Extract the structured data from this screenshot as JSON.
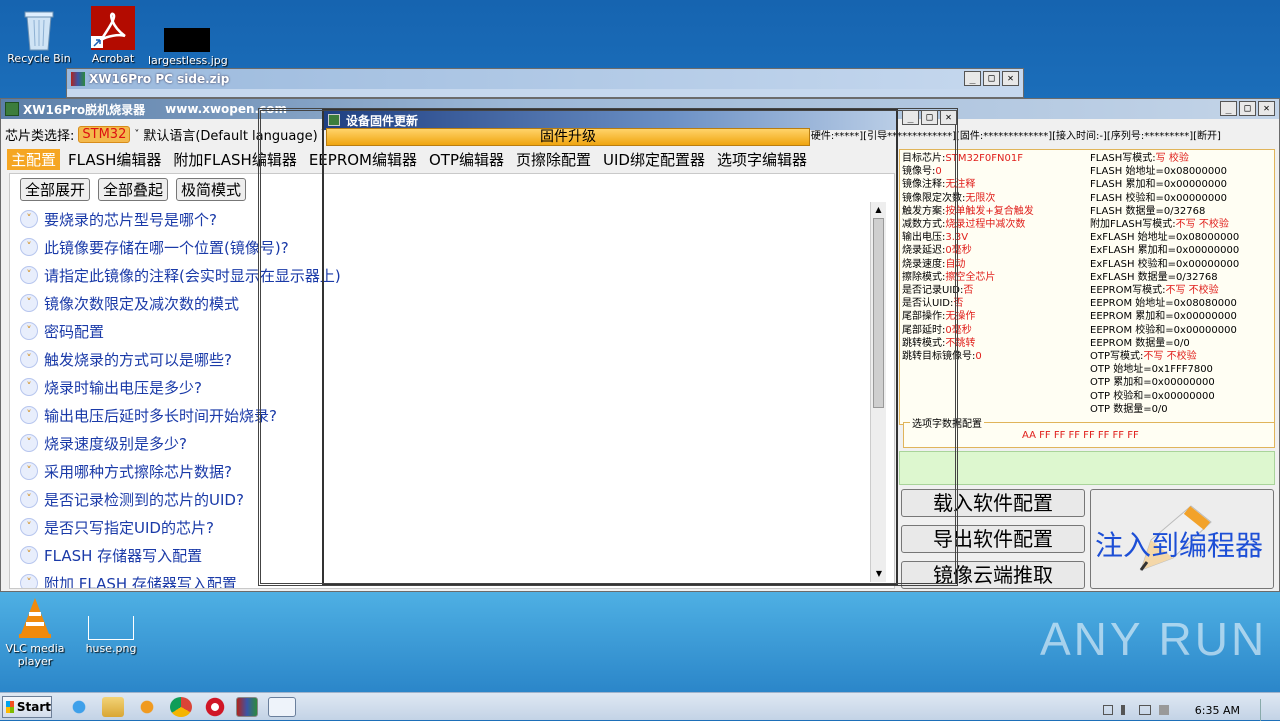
{
  "desktop": {
    "icons": [
      {
        "name": "recycle-bin",
        "label": "Recycle Bin"
      },
      {
        "name": "acrobat",
        "label": "Acrobat"
      },
      {
        "name": "largestless",
        "label": "largestless.jpg"
      },
      {
        "name": "vlc",
        "label": "VLC media player"
      },
      {
        "name": "huse",
        "label": "huse.png"
      }
    ],
    "watermark": "ANY RUN"
  },
  "zip_window": {
    "title": "XW16Pro PC side.zip"
  },
  "app": {
    "title": "XW16Pro脱机烧录器",
    "url": "www.xwopen.com",
    "chip_select_label": "芯片类选择:",
    "chip_value": "STM32",
    "language": "默认语言(Default language)",
    "status_bar": "[硬件:*****][引导*************][固件:*************][接入时间:-][序列号:*********][断开]",
    "tabs": [
      "主配置",
      "FLASH编辑器",
      "附加FLASH编辑器",
      "EEPROM编辑器",
      "OTP编辑器",
      "页擦除配置",
      "UID绑定配置器",
      "选项字编辑器"
    ],
    "buttons": {
      "expand": "全部展开",
      "collapse": "全部叠起",
      "minimal": "极简模式"
    },
    "questions": [
      "要烧录的芯片型号是哪个?",
      "此镜像要存储在哪一个位置(镜像号)?",
      "请指定此镜像的注释(会实时显示在显示器上)",
      "镜像次数限定及减次数的模式",
      "密码配置",
      "触发烧录的方式可以是哪些?",
      "烧录时输出电压是多少?",
      "输出电压后延时多长时间开始烧录?",
      "烧录速度级别是多少?",
      "采用哪种方式擦除芯片数据?",
      "是否记录检测到的芯片的UID?",
      "是否只写指定UID的芯片?",
      "FLASH 存储器写入配置",
      "附加 FLASH 存储器写入配置"
    ],
    "info_left": [
      {
        "k": "目标芯片:",
        "v": "STM32F0FN01F"
      },
      {
        "k": "镜像号:",
        "v": "0"
      },
      {
        "k": "镜像注释:",
        "v": "无注释"
      },
      {
        "k": "镜像限定次数:",
        "v": "无限次"
      },
      {
        "k": "触发方案:",
        "v": "按单触发+复合触发"
      },
      {
        "k": "减数方式:",
        "v": "烧录过程中减次数"
      },
      {
        "k": "输出电压:",
        "v": "3.3V"
      },
      {
        "k": "烧录延迟:",
        "v": "0毫秒"
      },
      {
        "k": "烧录速度:",
        "v": "自动"
      },
      {
        "k": "擦除模式:",
        "v": "擦空全芯片"
      },
      {
        "k": "是否记录UID:",
        "v": "否"
      },
      {
        "k": "是否认UID:",
        "v": "否"
      },
      {
        "k": "尾部操作:",
        "v": "无操作"
      },
      {
        "k": "尾部延时:",
        "v": "0毫秒"
      },
      {
        "k": "跳转模式:",
        "v": "不跳转"
      },
      {
        "k": "跳转目标镜像号:",
        "v": "0"
      }
    ],
    "info_right": [
      {
        "k": "FLASH写模式:",
        "v": "写 校验"
      },
      {
        "k": "FLASH 始地址=0x08000000",
        "v": ""
      },
      {
        "k": "FLASH 累加和=0x00000000",
        "v": ""
      },
      {
        "k": "FLASH 校验和=0x00000000",
        "v": ""
      },
      {
        "k": "FLASH 数据量=0/32768",
        "v": ""
      },
      {
        "k": "附加FLASH写模式:",
        "v": "不写 不校验"
      },
      {
        "k": "ExFLASH 始地址=0x08000000",
        "v": ""
      },
      {
        "k": "ExFLASH 累加和=0x00000000",
        "v": ""
      },
      {
        "k": "ExFLASH 校验和=0x00000000",
        "v": ""
      },
      {
        "k": "ExFLASH 数据量=0/32768",
        "v": ""
      },
      {
        "k": "EEPROM写模式:",
        "v": "不写 不校验"
      },
      {
        "k": "EEPROM 始地址=0x08080000",
        "v": ""
      },
      {
        "k": "EEPROM 累加和=0x00000000",
        "v": ""
      },
      {
        "k": "EEPROM 校验和=0x00000000",
        "v": ""
      },
      {
        "k": "EEPROM 数据量=0/0",
        "v": ""
      },
      {
        "k": "OTP写模式:",
        "v": "不写 不校验"
      },
      {
        "k": "OTP 始地址=0x1FFF7800",
        "v": ""
      },
      {
        "k": "OTP 累加和=0x00000000",
        "v": ""
      },
      {
        "k": "OTP 校验和=0x00000000",
        "v": ""
      },
      {
        "k": "OTP 数据量=0/0",
        "v": ""
      }
    ],
    "option_bytes_label": "选项字数据配置",
    "option_bytes_value": "AA FF FF FF FF FF FF FF",
    "load_config": "载入软件配置",
    "export_config": "导出软件配置",
    "cloud_fetch": "镜像云端推取",
    "inject": "注入到编程器"
  },
  "dialog": {
    "title": "设备固件更新",
    "upgrade_button": "固件升级"
  },
  "taskbar": {
    "start": "Start",
    "time": "6:35 AM"
  }
}
